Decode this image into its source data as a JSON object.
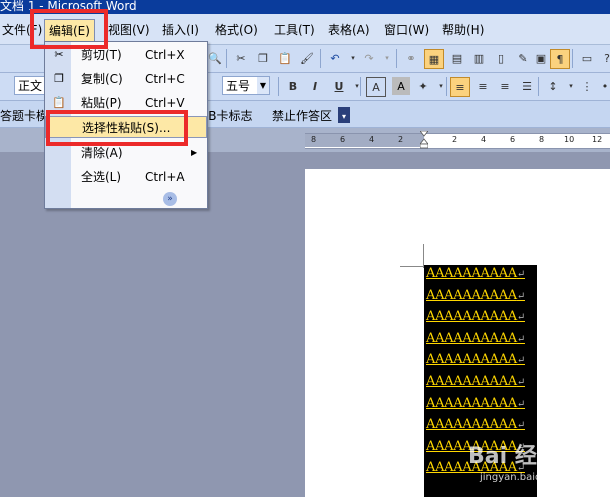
{
  "window": {
    "title": "文档 1 - Microsoft Word"
  },
  "menubar": {
    "items": [
      {
        "label": "文件(F)"
      },
      {
        "label": "编辑(E)"
      },
      {
        "label": "视图(V)"
      },
      {
        "label": "插入(I)"
      },
      {
        "label": "格式(O)"
      },
      {
        "label": "工具(T)"
      },
      {
        "label": "表格(A)"
      },
      {
        "label": "窗口(W)"
      },
      {
        "label": "帮助(H)"
      }
    ]
  },
  "formatting": {
    "style": "正文",
    "font_size": "五号",
    "bold": "B",
    "italic": "I",
    "underline": "U",
    "char_border": "A",
    "font_color": "A"
  },
  "toolbar3": {
    "partial_left": "答题卡模",
    "item1": "AB卡标志",
    "item2": "禁止作答区"
  },
  "edit_menu": {
    "items": [
      {
        "label": "剪切(T)",
        "shortcut": "Ctrl+X",
        "icon": "scissors-icon"
      },
      {
        "label": "复制(C)",
        "shortcut": "Ctrl+C",
        "icon": "copy-icon"
      },
      {
        "label": "粘贴(P)",
        "shortcut": "Ctrl+V",
        "icon": "paste-icon"
      },
      {
        "label": "选择性粘贴(S)...",
        "shortcut": "",
        "icon": ""
      },
      {
        "label": "清除(A)",
        "shortcut": "",
        "icon": "",
        "submenu": true
      },
      {
        "label": "全选(L)",
        "shortcut": "Ctrl+A",
        "icon": ""
      }
    ],
    "expand_glyph": "»"
  },
  "ruler": {
    "ticks": [
      "8",
      "6",
      "4",
      "2",
      "2",
      "4",
      "6",
      "8",
      "10",
      "12"
    ]
  },
  "document": {
    "lines": [
      "AAAAAAAAAA",
      "AAAAAAAAAA",
      "AAAAAAAAAA",
      "AAAAAAAAAA",
      "AAAAAAAAAA",
      "AAAAAAAAAA",
      "AAAAAAAAAA",
      "AAAAAAAAAA",
      "AAAAAAAAAA",
      "AAAAAAAAAA"
    ],
    "paragraph_mark": "↵",
    "text_color": "#ffd700",
    "highlight_color": "#000000"
  },
  "watermark": {
    "text": "Bai 经验",
    "url": "jingyan.baidu.com"
  },
  "colors": {
    "annotation_red": "#ec2a2a",
    "menu_highlight": "#fde8a6",
    "titlebar": "#0a3c9c"
  }
}
